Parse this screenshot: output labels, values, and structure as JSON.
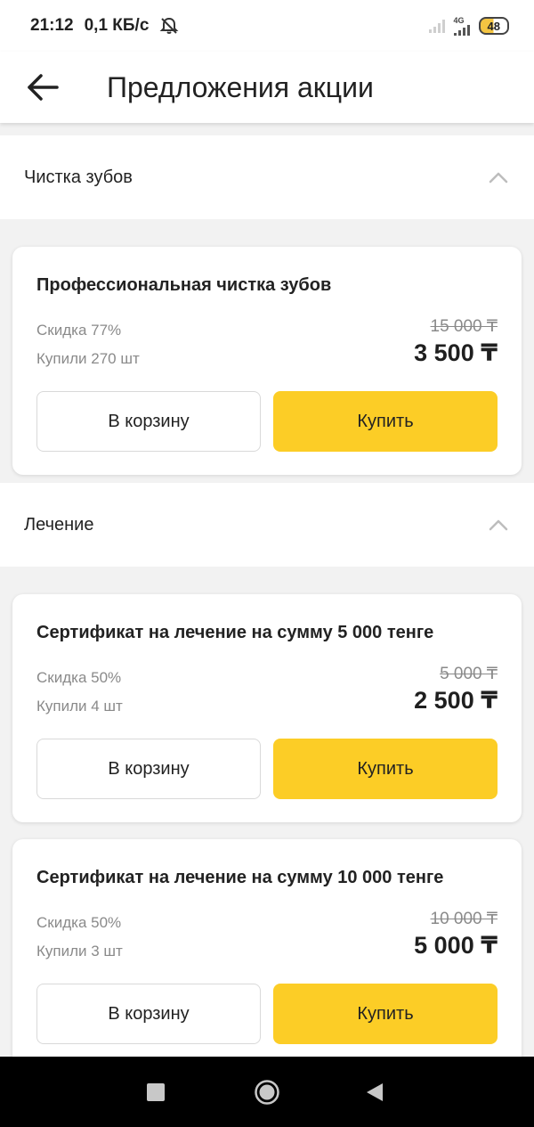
{
  "status_bar": {
    "time": "21:12",
    "speed": "0,1 КБ/с",
    "network_type": "4G",
    "battery": "48"
  },
  "header": {
    "title": "Предложения акции"
  },
  "sections": [
    {
      "title": "Чистка зубов",
      "items": [
        {
          "title": "Профессиональная чистка зубов",
          "discount": "Скидка 77%",
          "bought": "Купили 270 шт",
          "old_price": "15 000 ₸",
          "price": "3 500 ₸",
          "cart_label": "В корзину",
          "buy_label": "Купить"
        }
      ]
    },
    {
      "title": "Лечение",
      "items": [
        {
          "title": "Сертификат на лечение на сумму 5 000 тенге",
          "discount": "Скидка 50%",
          "bought": "Купили 4 шт",
          "old_price": "5 000 ₸",
          "price": "2 500 ₸",
          "cart_label": "В корзину",
          "buy_label": "Купить"
        },
        {
          "title": "Сертификат на лечение на сумму 10 000 тенге",
          "discount": "Скидка 50%",
          "bought": "Купили 3 шт",
          "old_price": "10 000 ₸",
          "price": "5 000 ₸",
          "cart_label": "В корзину",
          "buy_label": "Купить"
        }
      ]
    }
  ],
  "colors": {
    "accent": "#fccd26",
    "background": "#f2f2f2"
  },
  "icons": {
    "back": "arrow-left-icon",
    "collapse": "chevron-up-icon",
    "mute": "bell-off-icon",
    "nav_recents": "square-icon",
    "nav_home": "circle-icon",
    "nav_back": "triangle-icon"
  }
}
